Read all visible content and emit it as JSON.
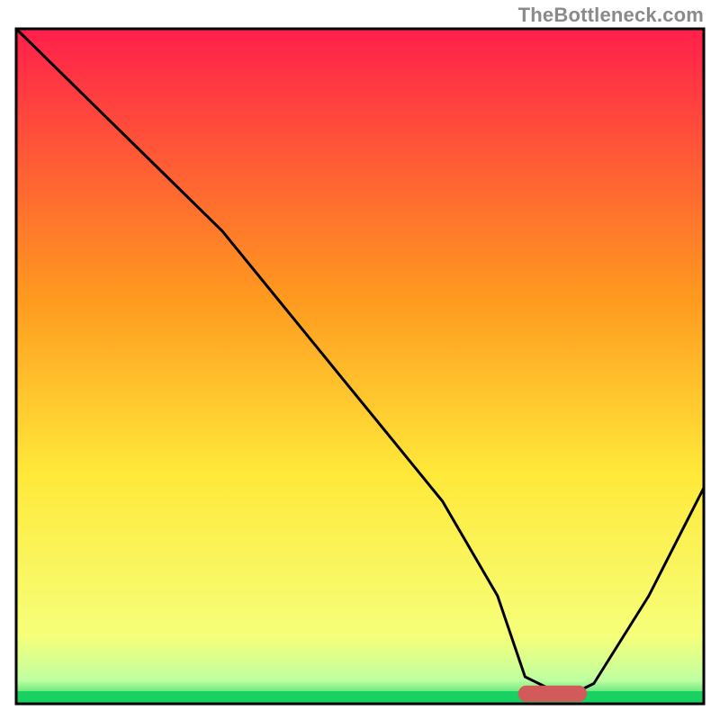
{
  "watermark": "TheBottleneck.com",
  "chart_data": {
    "type": "line",
    "title": "",
    "xlabel": "",
    "ylabel": "",
    "xlim": [
      0,
      100
    ],
    "ylim": [
      0,
      100
    ],
    "grid": false,
    "legend": false,
    "background_gradient": {
      "top": "#ff1f4b",
      "mid1": "#ff9a1f",
      "mid2": "#ffe93a",
      "mid3": "#f6ff7a",
      "bottom": "#17d160"
    },
    "optimal_marker": {
      "x_start": 73,
      "x_end": 83,
      "y": 1.5,
      "color": "#d25a5a"
    },
    "series": [
      {
        "name": "bottleneck-curve",
        "color": "#000000",
        "x": [
          0,
          8,
          16,
          24,
          30,
          38,
          46,
          54,
          62,
          70,
          74,
          80,
          84,
          92,
          100
        ],
        "y": [
          100,
          92,
          84,
          76,
          70,
          60,
          50,
          40,
          30,
          16,
          4,
          1,
          3,
          16,
          32
        ]
      }
    ]
  }
}
